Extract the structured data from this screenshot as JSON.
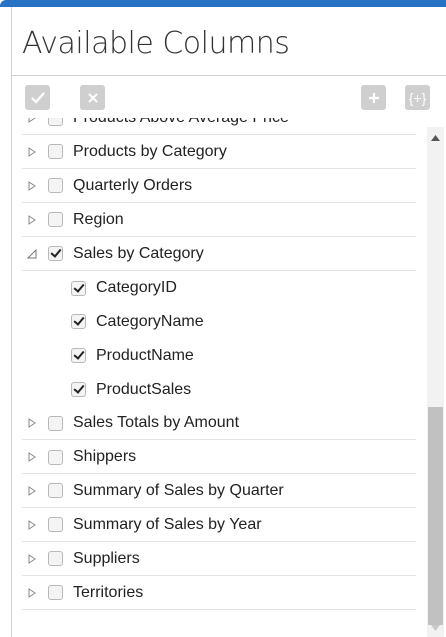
{
  "header": {
    "title": "Available Columns"
  },
  "toolbar": {
    "check_icon": "check-icon",
    "clear_icon": "close-icon",
    "add_icon": "plus-icon",
    "expression_icon": "braces-plus-icon",
    "expression_glyph": "{+}"
  },
  "tree": {
    "items": [
      {
        "label": "Products Above Average Price",
        "checked": false,
        "expanded": false
      },
      {
        "label": "Products by Category",
        "checked": false,
        "expanded": false
      },
      {
        "label": "Quarterly Orders",
        "checked": false,
        "expanded": false
      },
      {
        "label": "Region",
        "checked": false,
        "expanded": false
      },
      {
        "label": "Sales by Category",
        "checked": true,
        "expanded": true
      },
      {
        "label": "CategoryID",
        "checked": true,
        "child": true
      },
      {
        "label": "CategoryName",
        "checked": true,
        "child": true
      },
      {
        "label": "ProductName",
        "checked": true,
        "child": true
      },
      {
        "label": "ProductSales",
        "checked": true,
        "child": true
      },
      {
        "label": "Sales Totals by Amount",
        "checked": false,
        "expanded": false
      },
      {
        "label": "Shippers",
        "checked": false,
        "expanded": false
      },
      {
        "label": "Summary of Sales by Quarter",
        "checked": false,
        "expanded": false
      },
      {
        "label": "Summary of Sales by Year",
        "checked": false,
        "expanded": false
      },
      {
        "label": "Suppliers",
        "checked": false,
        "expanded": false
      },
      {
        "label": "Territories",
        "checked": false,
        "expanded": false
      }
    ]
  },
  "colors": {
    "accent": "#2872c6",
    "button_gray": "#cfcfcf",
    "scroll_thumb": "#c1c1c1"
  }
}
